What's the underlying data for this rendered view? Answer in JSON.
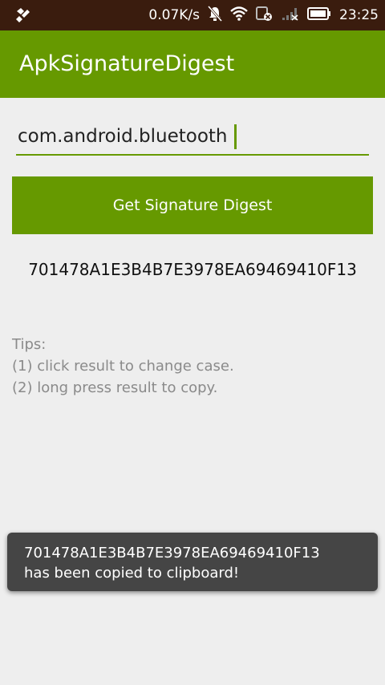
{
  "status_bar": {
    "network_speed": "0.07K/s",
    "time": "23:25",
    "icons": [
      "app-notification-icon",
      "mute-icon",
      "wifi-icon",
      "sim-icon",
      "signal-icon",
      "battery-icon"
    ]
  },
  "app_bar": {
    "title": "ApkSignatureDigest"
  },
  "package_input": {
    "value": "com.android.bluetooth"
  },
  "digest_button": {
    "label": "Get Signature Digest"
  },
  "result": {
    "digest": "701478A1E3B4B7E3978EA69469410F13"
  },
  "tips": {
    "heading": "Tips:",
    "lines": [
      "(1) click result to change case.",
      "(2) long press result to copy."
    ]
  },
  "toast": {
    "line1": "701478A1E3B4B7E3978EA69469410F13",
    "line2": "has been copied to clipboard!"
  },
  "colors": {
    "accent": "#669900",
    "status_bar": "#3a1c0e",
    "background": "#eeeeee",
    "toast": "#454545"
  }
}
